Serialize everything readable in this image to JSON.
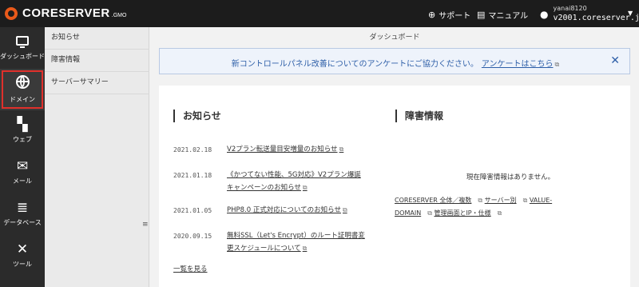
{
  "brand": {
    "name": "CORESERVER",
    "suffix": ".GMO"
  },
  "header": {
    "support_label": "サポート",
    "manual_label": "マニュアル",
    "user_name": "yanai8120",
    "user_host": "v2001.coreserver.jp"
  },
  "nav": [
    {
      "label": "ダッシュボード",
      "icon": "monitor-icon"
    },
    {
      "label": "ドメイン",
      "icon": "globe-icon",
      "active": true
    },
    {
      "label": "ウェブ",
      "icon": "grid-plus-icon"
    },
    {
      "label": "メール",
      "icon": "envelope-icon"
    },
    {
      "label": "データベース",
      "icon": "database-icon"
    },
    {
      "label": "ツール",
      "icon": "tools-icon"
    }
  ],
  "submenu": [
    "お知らせ",
    "障害情報",
    "サーバーサマリー"
  ],
  "main": {
    "title": "ダッシュボード",
    "notice_text": "新コントロールパネル改善についてのアンケートにご協力ください。",
    "notice_link": "アンケートはこちら",
    "news_title": "お知らせ",
    "news": [
      {
        "date": "2021.02.18",
        "title": "V2プラン転送量目安増量のお知らせ"
      },
      {
        "date": "2021.01.18",
        "title": "《かつてない性能、5G対応》V2プラン爆誕キャンペーンのお知らせ"
      },
      {
        "date": "2021.01.05",
        "title": "PHP8.0 正式対応についてのお知らせ"
      },
      {
        "date": "2020.09.15",
        "title": "無料SSL（Let's Encrypt）のルート証明書変更スケジュールについて"
      }
    ],
    "more_label": "一覧を見る",
    "fault_title": "障害情報",
    "fault_message": "現在障害情報はありません。",
    "fault_links": [
      "CORESERVER 全体／複数",
      "サーバー別",
      "VALUE-DOMAIN",
      "管理画面とIP・仕様"
    ]
  },
  "colors": {
    "topbar": "#1c1c1c",
    "accent": "#e8591a",
    "active_outline": "#e0302b",
    "notice_blue": "#2e5fa8"
  }
}
